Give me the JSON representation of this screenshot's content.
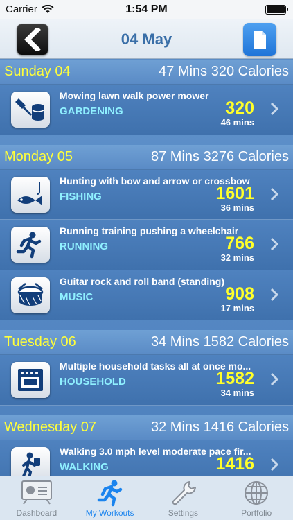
{
  "status_bar": {
    "carrier": "Carrier",
    "time": "1:54 PM",
    "battery_level": 1.0
  },
  "nav": {
    "title": "04 May",
    "back_icon": "chevron-left-icon",
    "action_icon": "document-icon"
  },
  "days": [
    {
      "name": "Sunday 04",
      "summary": "47 Mins 320 Calories",
      "workouts": [
        {
          "title": "Mowing lawn walk power mower",
          "category": "GARDENING",
          "calories": "320",
          "minutes": "46 mins",
          "icon": "gardening-icon"
        }
      ]
    },
    {
      "name": "Monday 05",
      "summary": "87 Mins 3276 Calories",
      "workouts": [
        {
          "title": "Hunting with bow and arrow or crossbow",
          "category": "FISHING",
          "calories": "1601",
          "minutes": "36 mins",
          "icon": "fish-icon"
        },
        {
          "title": "Running training pushing a wheelchair",
          "category": "RUNNING",
          "calories": "766",
          "minutes": "32 mins",
          "icon": "runner-icon"
        },
        {
          "title": "Guitar rock and roll band (standing)",
          "category": "MUSIC",
          "calories": "908",
          "minutes": "17 mins",
          "icon": "drum-icon"
        }
      ]
    },
    {
      "name": "Tuesday 06",
      "summary": "34 Mins 1582 Calories",
      "workouts": [
        {
          "title": "Multiple household tasks all at once mo...",
          "category": "HOUSEHOLD",
          "calories": "1582",
          "minutes": "34 mins",
          "icon": "oven-icon"
        }
      ]
    },
    {
      "name": "Wednesday 07",
      "summary": "32 Mins 1416 Calories",
      "workouts": [
        {
          "title": "Walking 3.0 mph level moderate pace fir...",
          "category": "WALKING",
          "calories": "1416",
          "minutes": "",
          "icon": "walker-icon"
        }
      ]
    }
  ],
  "tabs": [
    {
      "label": "Dashboard",
      "icon": "dashboard-icon",
      "active": false
    },
    {
      "label": "My Workouts",
      "icon": "runner-tab-icon",
      "active": true
    },
    {
      "label": "Settings",
      "icon": "wrench-icon",
      "active": false
    },
    {
      "label": "Portfolio",
      "icon": "globe-icon",
      "active": false
    }
  ],
  "colors": {
    "day_name": "#ffff3a",
    "calories": "#ffff2a",
    "category": "#8ff0ff",
    "active_tab": "#1b84ee",
    "nav_title": "#3a6fa8"
  }
}
